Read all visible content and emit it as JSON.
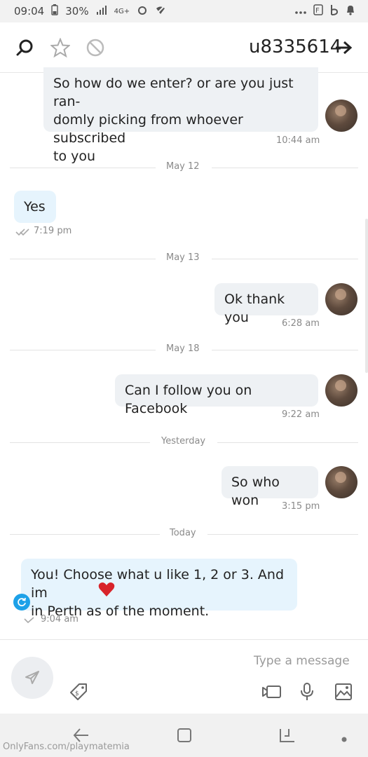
{
  "status_bar": {
    "time": "09:04",
    "battery": "30%",
    "network": "4G+"
  },
  "header": {
    "title": "u8335614"
  },
  "composer": {
    "placeholder": "Type a message"
  },
  "watermark": "OnlyFans.com/playmatemia",
  "messages": [
    {
      "text": "So how do we enter? or are you just ran-\ndomly picking from whoever subscribed\nto you",
      "time": "10:44 am"
    },
    {
      "text": "Yes",
      "time": "7:19 pm"
    },
    {
      "text": "Ok thank you",
      "time": "6:28 am"
    },
    {
      "text": "Can I follow you on Facebook",
      "time": "9:22 am"
    },
    {
      "text": "So who won",
      "time": "3:15 pm"
    },
    {
      "text": "You! Choose what u like 1, 2 or 3. And im\nin Perth as of the moment.",
      "time": "9:04 am"
    }
  ],
  "dividers": [
    "May 12",
    "May 13",
    "May 18",
    "Yesterday",
    "Today"
  ],
  "colors": {
    "incoming_bubble": "#eef1f4",
    "outgoing_bubble": "#e6f4fd",
    "accent": "#1da1e8"
  }
}
